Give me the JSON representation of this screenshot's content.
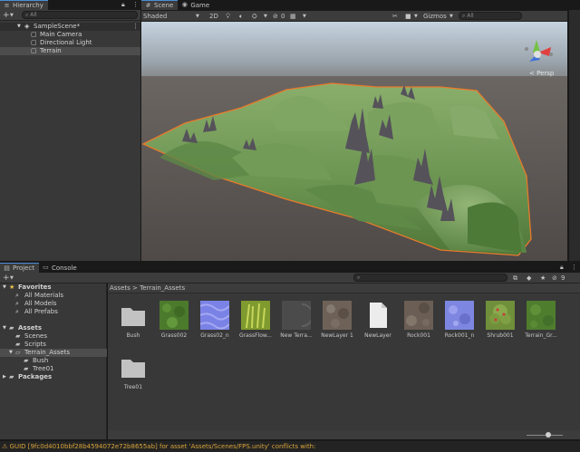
{
  "colors": {
    "selection": "#4a8cd8",
    "terrain_outline": "#e87a2c",
    "warning": "#d9a53a"
  },
  "hierarchy": {
    "tab_label": "Hierarchy",
    "add_label": "+",
    "search_placeholder": "All",
    "items": [
      {
        "label": "SampleScene*"
      },
      {
        "label": "Main Camera"
      },
      {
        "label": "Directional Light"
      },
      {
        "label": "Terrain"
      }
    ]
  },
  "scene_view": {
    "tabs": [
      {
        "label": "Scene"
      },
      {
        "label": "Game"
      }
    ],
    "shading_mode": "Shaded",
    "mode_2d": "2D",
    "hidden_count": "0",
    "gizmos_label": "Gizmos",
    "search_placeholder": "All",
    "projection_label": "Persp"
  },
  "project": {
    "tabs": [
      {
        "label": "Project"
      },
      {
        "label": "Console"
      }
    ],
    "add_label": "+",
    "hidden_count": "9",
    "breadcrumb": [
      "Assets",
      "Terrain_Assets"
    ],
    "sidebar": [
      {
        "label": "Favorites"
      },
      {
        "label": "All Materials"
      },
      {
        "label": "All Models"
      },
      {
        "label": "All Prefabs"
      },
      {
        "label": "Assets"
      },
      {
        "label": "Scenes"
      },
      {
        "label": "Scripts"
      },
      {
        "label": "Terrain_Assets"
      },
      {
        "label": "Bush"
      },
      {
        "label": "Tree01"
      },
      {
        "label": "Packages"
      }
    ],
    "assets": [
      {
        "label": "Bush",
        "icon": "folder-icon"
      },
      {
        "label": "Grass002",
        "icon": "grass-texture-icon"
      },
      {
        "label": "Grass02_n",
        "icon": "normal-map-icon"
      },
      {
        "label": "GrassFlow...",
        "icon": "grass-flower-icon"
      },
      {
        "label": "New Terra...",
        "icon": "terrain-layer-icon"
      },
      {
        "label": "NewLayer 1",
        "icon": "rock-texture-icon"
      },
      {
        "label": "NewLayer",
        "icon": "document-icon"
      },
      {
        "label": "Rock001",
        "icon": "rock-texture-icon"
      },
      {
        "label": "Rock001_n",
        "icon": "normal-map-icon"
      },
      {
        "label": "Shrub001",
        "icon": "shrub-icon"
      },
      {
        "label": "Terrain_Gr...",
        "icon": "grass-texture-icon"
      },
      {
        "label": "Tree01",
        "icon": "folder-icon"
      }
    ]
  },
  "status_bar": {
    "message": "GUID [9fc0d4010bbf28b4594072e72b8655ab] for asset 'Assets/Scenes/FPS.unity' conflicts with:"
  }
}
